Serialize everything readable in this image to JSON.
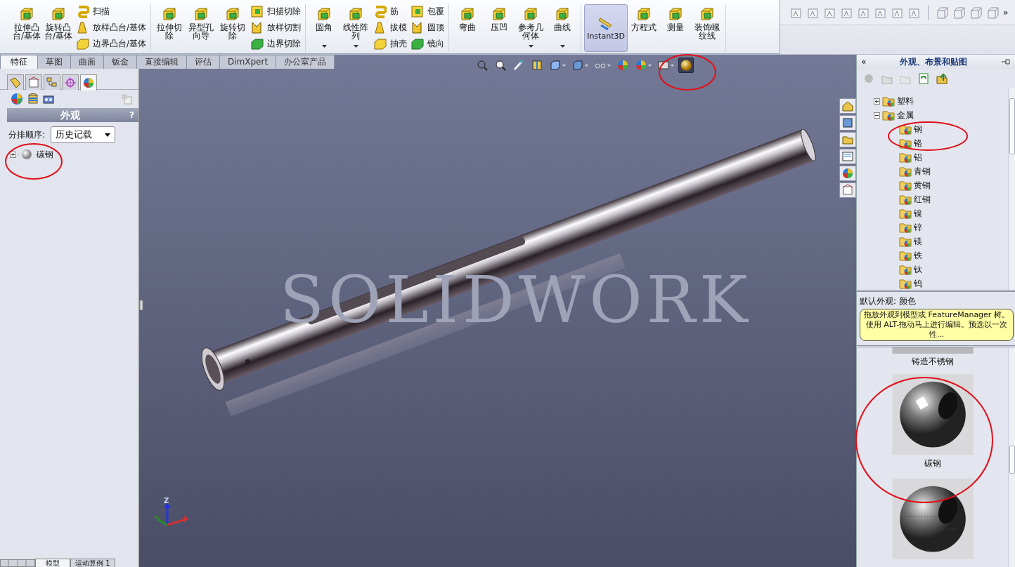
{
  "ribbon": {
    "groups": [
      {
        "items": [
          {
            "kind": "large",
            "label": "拉伸凸台/基体"
          },
          {
            "kind": "large",
            "label": "旋转凸台/基体"
          },
          {
            "kind": "stack",
            "buttons": [
              "扫描",
              "放样凸台/基体",
              "边界凸台/基体"
            ]
          }
        ]
      },
      {
        "items": [
          {
            "kind": "large",
            "label": "拉伸切除"
          },
          {
            "kind": "large",
            "label": "异型孔向导"
          },
          {
            "kind": "large",
            "label": "旋转切除"
          },
          {
            "kind": "stack",
            "buttons": [
              "扫描切除",
              "放样切割",
              "边界切除"
            ]
          }
        ]
      },
      {
        "items": [
          {
            "kind": "split",
            "label": "圆角"
          },
          {
            "kind": "split",
            "label": "线性阵列"
          },
          {
            "kind": "stack",
            "buttons": [
              "筋",
              "拔模",
              "抽壳"
            ]
          },
          {
            "kind": "stack",
            "buttons": [
              "包覆",
              "圆顶",
              "镜向"
            ]
          }
        ]
      },
      {
        "items": [
          {
            "kind": "large",
            "label": "弯曲"
          },
          {
            "kind": "large",
            "label": "压凹"
          },
          {
            "kind": "split",
            "label": "参考几何体"
          },
          {
            "kind": "split",
            "label": "曲线"
          }
        ]
      },
      {
        "items": [
          {
            "kind": "toggle",
            "label": "Instant3D",
            "on": true
          },
          {
            "kind": "large",
            "label": "方程式"
          },
          {
            "kind": "large",
            "label": "测量"
          },
          {
            "kind": "large",
            "label": "装饰螺纹线"
          }
        ]
      }
    ]
  },
  "quick_toolbar": {
    "overflow": "»"
  },
  "feature_tabs": [
    {
      "label": "特征",
      "selected": true
    },
    {
      "label": "草图",
      "selected": false
    },
    {
      "label": "曲面",
      "selected": false
    },
    {
      "label": "钣金",
      "selected": false
    },
    {
      "label": "直接编辑",
      "selected": false
    },
    {
      "label": "评估",
      "selected": false
    },
    {
      "label": "DimXpert",
      "selected": false
    },
    {
      "label": "办公室产品",
      "selected": false
    }
  ],
  "view_tools": [
    {
      "dropdown": false,
      "selected": false
    },
    {
      "dropdown": false,
      "selected": false
    },
    {
      "dropdown": false,
      "selected": false
    },
    {
      "dropdown": false,
      "selected": false
    },
    {
      "dropdown": true,
      "selected": false
    },
    {
      "dropdown": true,
      "selected": false
    },
    {
      "dropdown": true,
      "selected": false
    },
    {
      "dropdown": false,
      "selected": false
    },
    {
      "dropdown": true,
      "selected": false
    },
    {
      "dropdown": true,
      "selected": false
    },
    {
      "dropdown": false,
      "selected": true
    }
  ],
  "left_panel": {
    "manager_tabs": [
      {
        "selected": false
      },
      {
        "selected": false
      },
      {
        "selected": false
      },
      {
        "selected": false
      },
      {
        "selected": true
      }
    ],
    "title": "外观",
    "help": "?",
    "sort_label": "分排顺序:",
    "sort_value": "历史记载",
    "tree": [
      {
        "label": "碳钢",
        "expanded": false
      }
    ],
    "bottom_tabs": [
      {
        "label": "模型",
        "selected": true
      },
      {
        "label": "运动算例 1",
        "selected": false
      }
    ]
  },
  "viewport": {
    "background_logo": "SOLIDWORK",
    "triad_label": "Z"
  },
  "task_pane": {
    "collapse": "«",
    "title": "外观、布景和贴图",
    "tree": [
      {
        "label": "塑料",
        "expanded": false
      },
      {
        "label": "金属",
        "expanded": true,
        "children": [
          {
            "label": "钢"
          },
          {
            "label": "铬"
          },
          {
            "label": "铝"
          },
          {
            "label": "青铜"
          },
          {
            "label": "黄铜"
          },
          {
            "label": "红铜"
          },
          {
            "label": "镍"
          },
          {
            "label": "锌"
          },
          {
            "label": "镁"
          },
          {
            "label": "铁"
          },
          {
            "label": "钛"
          },
          {
            "label": "钨"
          }
        ]
      }
    ],
    "default_label": "默认外观: 颜色",
    "tooltip": "拖放外观到模型或 FeatureManager 树。使用 ALT-拖动马上进行编辑。预选以一次性...",
    "swatches": [
      {
        "kind": "strip",
        "label": "铸造不锈钢"
      },
      {
        "kind": "polished",
        "label": "碳钢"
      },
      {
        "kind": "cast"
      }
    ]
  }
}
